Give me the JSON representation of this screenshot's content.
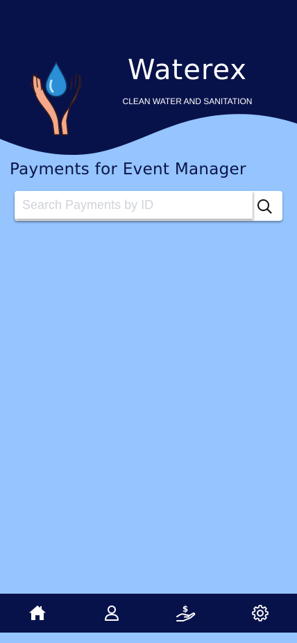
{
  "header": {
    "brand": "Waterex",
    "tagline": "CLEAN WATER AND SANITATION",
    "background_color": "#08124a"
  },
  "page": {
    "title": "Payments for Event Manager",
    "background_color": "#95c4fe"
  },
  "search": {
    "placeholder": "Search Payments by ID",
    "value": "",
    "icon": "search-icon"
  },
  "bottom_nav": {
    "items": [
      {
        "icon": "home-icon"
      },
      {
        "icon": "user-icon"
      },
      {
        "icon": "payment-hand-icon"
      },
      {
        "icon": "gear-icon"
      }
    ]
  }
}
